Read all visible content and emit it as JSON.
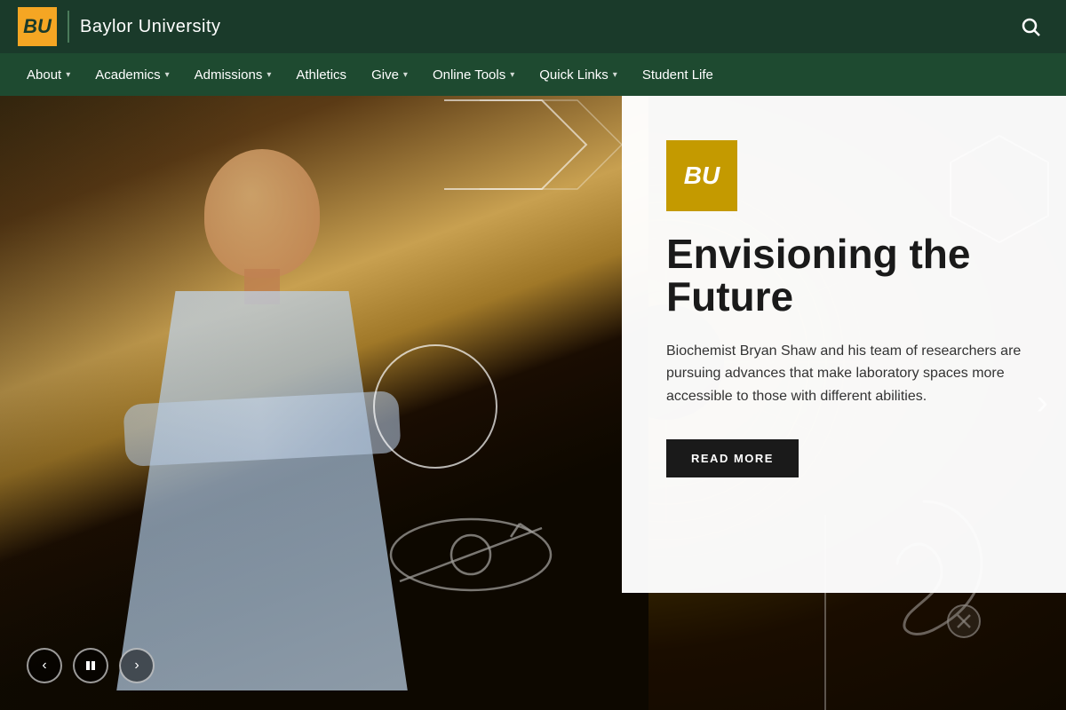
{
  "header": {
    "logo_text": "Baylor University",
    "logo_bu": "BU",
    "search_label": "Search"
  },
  "nav": {
    "items": [
      {
        "id": "about",
        "label": "About",
        "has_dropdown": true
      },
      {
        "id": "academics",
        "label": "Academics",
        "has_dropdown": true
      },
      {
        "id": "admissions",
        "label": "Admissions",
        "has_dropdown": true
      },
      {
        "id": "athletics",
        "label": "Athletics",
        "has_dropdown": false
      },
      {
        "id": "give",
        "label": "Give",
        "has_dropdown": true
      },
      {
        "id": "online-tools",
        "label": "Online Tools",
        "has_dropdown": true
      },
      {
        "id": "quick-links",
        "label": "Quick Links",
        "has_dropdown": true
      },
      {
        "id": "student-life",
        "label": "Student Life",
        "has_dropdown": false
      }
    ]
  },
  "hero": {
    "bu_logo": "BU",
    "title": "Envisioning the Future",
    "description": "Biochemist Bryan Shaw and his team of researchers are pursuing advances that make laboratory spaces more accessible to those with different abilities.",
    "read_more_label": "READ MORE",
    "slide_prev_label": "‹",
    "slide_pause_label": "⏸",
    "slide_next_label": "›",
    "next_arrow_label": "›"
  }
}
